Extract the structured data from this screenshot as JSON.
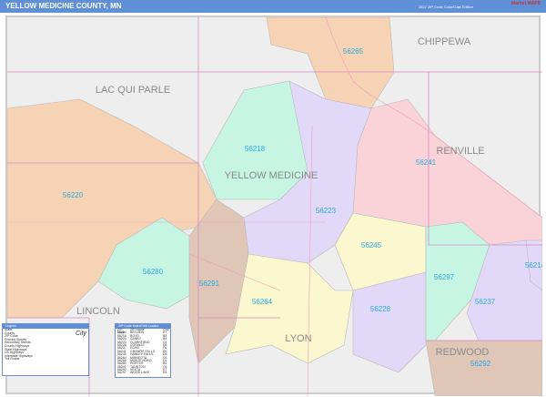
{
  "header": {
    "title": "YELLOW MEDICINE COUNTY, MN",
    "edition": "2022 ZIP Code Color/Cast Edition",
    "logo": "Market MAPS"
  },
  "counties": [
    {
      "name": "CHIPPEWA"
    },
    {
      "name": "LAC QUI PARLE"
    },
    {
      "name": "YELLOW MEDICINE"
    },
    {
      "name": "RENVILLE"
    },
    {
      "name": "LINCOLN"
    },
    {
      "name": "LYON"
    },
    {
      "name": "REDWOOD"
    }
  ],
  "zips": [
    {
      "zip": "56265",
      "color": "#f7d3b5"
    },
    {
      "zip": "56218",
      "color": "#c7f5e3"
    },
    {
      "zip": "56241",
      "color": "#f9d3d8"
    },
    {
      "zip": "56220",
      "color": "#f7d3b5"
    },
    {
      "zip": "56223",
      "color": "#e2d8f8"
    },
    {
      "zip": "56245",
      "color": "#fbf7cf"
    },
    {
      "zip": "56280",
      "color": "#c7f5e3"
    },
    {
      "zip": "56291",
      "color": "#dfc6b7"
    },
    {
      "zip": "56264",
      "color": "#fbf7cf"
    },
    {
      "zip": "56228",
      "color": "#e2d8f8"
    },
    {
      "zip": "56297",
      "color": "#c7f5e3"
    },
    {
      "zip": "56237",
      "color": "#e2d8f8"
    },
    {
      "zip": "56214",
      "color": "#e2d8f8"
    },
    {
      "zip": "56292",
      "color": "#dfc6b7"
    }
  ],
  "zip_table": {
    "title": "ZIP Code Index/Grid Locator",
    "headers": [
      "ZIP Code",
      "ZIP Name",
      "Grid"
    ],
    "rows": [
      [
        "56214",
        "BELVIEW",
        "E7"
      ],
      [
        "56218",
        "BOYD",
        "B3"
      ],
      [
        "56220",
        "CANBY",
        "B4"
      ],
      [
        "56223",
        "CLARKFIELD",
        "C4"
      ],
      [
        "56228",
        "COSMOS",
        "D6"
      ],
      [
        "56237",
        "ECHO",
        "F6"
      ],
      [
        "56241",
        "GRANITE FALLS",
        "D3"
      ],
      [
        "56245",
        "HANLEY FALLS",
        "D5"
      ],
      [
        "56264",
        "MINNEOTA",
        "C6"
      ],
      [
        "56265",
        "MONTEVIDEO",
        "D1"
      ],
      [
        "56280",
        "PORTER",
        "B5"
      ],
      [
        "56291",
        "TAUNTON",
        "C6"
      ],
      [
        "56292",
        "VESTA",
        "E7"
      ],
      [
        "56297",
        "WOOD LAKE",
        "E5"
      ]
    ]
  },
  "legend": {
    "items": [
      "State",
      "County",
      "ZIP Code",
      "Primary Streets",
      "Secondary Streets",
      "County Highways",
      "State Highways",
      "US Highways",
      "Interstate Highways",
      "Toll Roads"
    ],
    "city_label": "City"
  }
}
